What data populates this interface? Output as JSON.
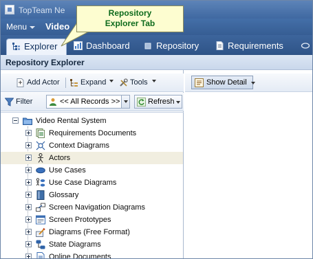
{
  "titlebar": {
    "title": "TopTeam Ne"
  },
  "menubar": {
    "menu_label": "Menu",
    "context_label": "Video"
  },
  "tabs": [
    {
      "label": "Explorer",
      "icon": "explorer-tree-icon",
      "active": true
    },
    {
      "label": "Dashboard",
      "icon": "chart-icon",
      "active": false
    },
    {
      "label": "Repository",
      "icon": "repository-icon",
      "active": false
    },
    {
      "label": "Requirements",
      "icon": "document-icon",
      "active": false
    }
  ],
  "panel": {
    "title": "Repository Explorer"
  },
  "toolbar": {
    "add_actor": "Add Actor",
    "expand": "Expand",
    "tools": "Tools",
    "filter": "Filter",
    "records": "<< All Records >>",
    "refresh": "Refresh",
    "show_detail": "Show Detail"
  },
  "tree": {
    "root": "Video Rental System",
    "items": [
      {
        "label": "Requirements Documents",
        "icon": "requirements-documents-icon"
      },
      {
        "label": "Context Diagrams",
        "icon": "context-diagram-icon"
      },
      {
        "label": "Actors",
        "icon": "actor-icon",
        "selected": true
      },
      {
        "label": "Use Cases",
        "icon": "use-case-icon"
      },
      {
        "label": "Use Case Diagrams",
        "icon": "use-case-diagram-icon"
      },
      {
        "label": "Glossary",
        "icon": "glossary-icon"
      },
      {
        "label": "Screen Navigation Diagrams",
        "icon": "screen-navigation-icon"
      },
      {
        "label": "Screen Prototypes",
        "icon": "screen-prototype-icon"
      },
      {
        "label": "Diagrams (Free Format)",
        "icon": "free-diagram-icon"
      },
      {
        "label": "State Diagrams",
        "icon": "state-diagram-icon"
      },
      {
        "label": "Online Documents",
        "icon": "online-document-icon"
      }
    ]
  },
  "callout": {
    "line1": "Repository",
    "line2": "Explorer Tab"
  },
  "colors": {
    "accent": "#3f68a1",
    "callout_text": "#0d6a1c",
    "callout_bg": "#fdfdd0",
    "selected_row": "#f1eee0"
  }
}
